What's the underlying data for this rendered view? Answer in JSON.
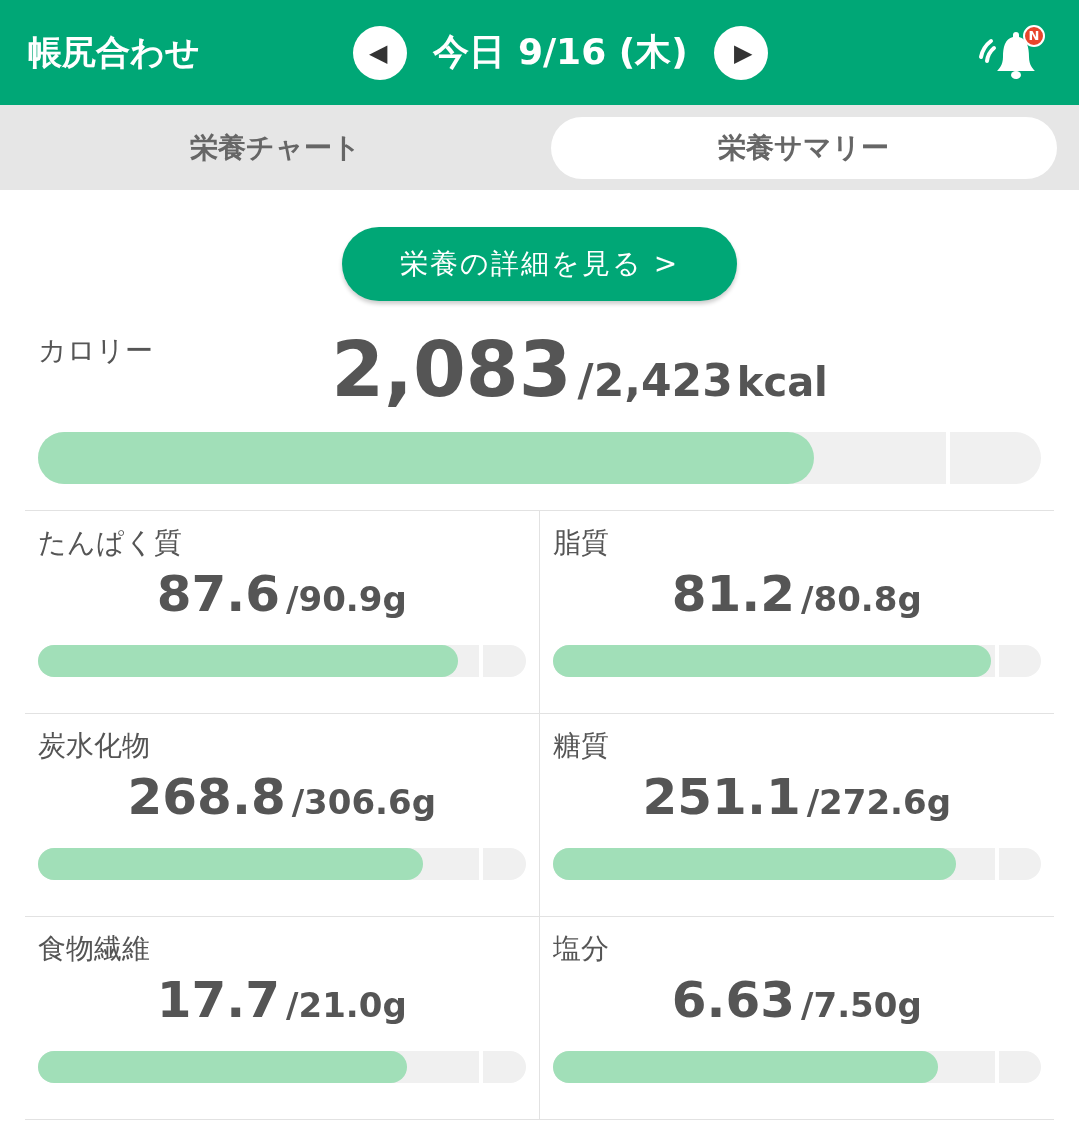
{
  "header": {
    "title": "帳尻合わせ",
    "prev": "◀",
    "date": "今日 9/16 (木)",
    "next": "▶",
    "notification_badge": "N"
  },
  "tabs": [
    {
      "label": "栄養チャート",
      "selected": false
    },
    {
      "label": "栄養サマリー",
      "selected": true
    }
  ],
  "detail_button": "栄養の詳細を見る >",
  "calories": {
    "label": "カロリー",
    "value": "2,083",
    "target": "/2,423",
    "unit": "kcal",
    "level": 0.774
  },
  "nutrients": [
    {
      "label": "たんぱく質",
      "value": "87.6",
      "target": "/90.9g",
      "level": 0.862
    },
    {
      "label": "脂質",
      "value": "81.2",
      "target": "/80.8g",
      "level": 0.898
    },
    {
      "label": "炭水化物",
      "value": "268.8",
      "target": "/306.6g",
      "level": 0.79
    },
    {
      "label": "糖質",
      "value": "251.1",
      "target": "/272.6g",
      "level": 0.826
    },
    {
      "label": "食物繊維",
      "value": "17.7",
      "target": "/21.0g",
      "level": 0.756
    },
    {
      "label": "塩分",
      "value": "6.63",
      "target": "/7.50g",
      "level": 0.789
    }
  ]
}
